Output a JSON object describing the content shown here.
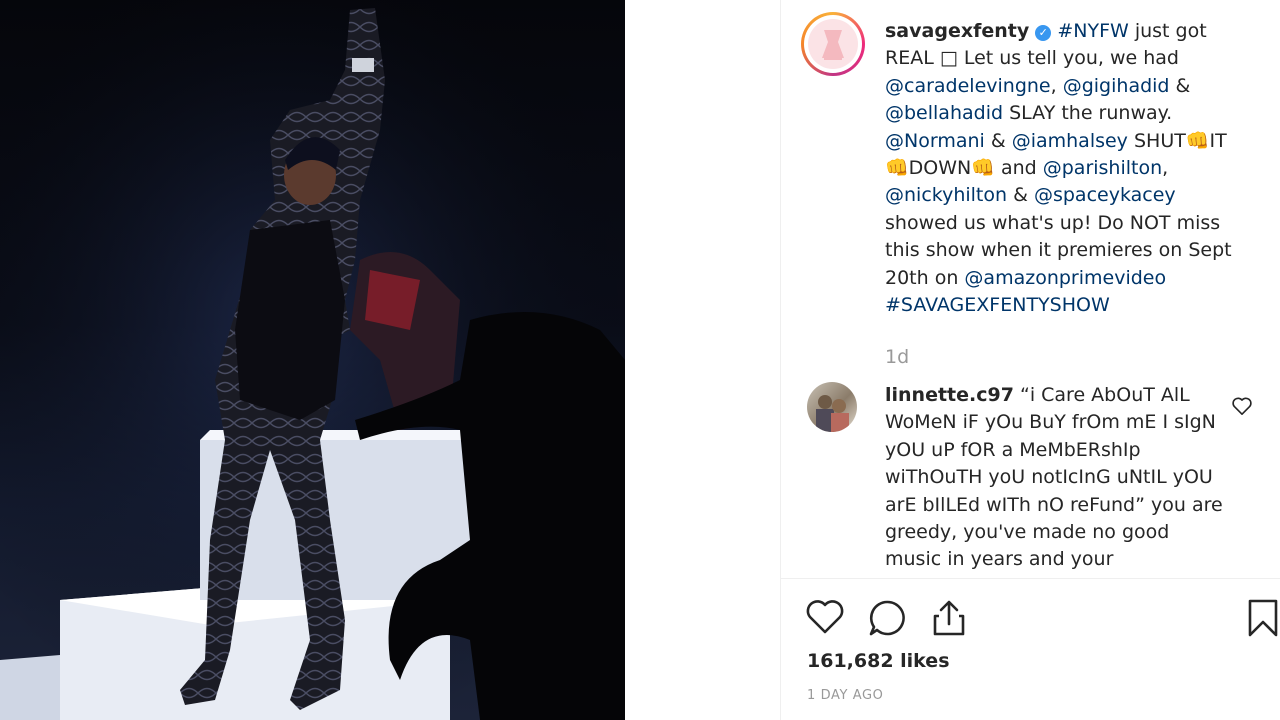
{
  "post": {
    "username": "savagexfenty",
    "caption_parts": [
      {
        "t": "#NYFW",
        "tag": true
      },
      {
        "t": " just got REAL □ Let us tell you, we had ",
        "tag": false
      },
      {
        "t": "@caradelevingne",
        "tag": true
      },
      {
        "t": ", ",
        "tag": false
      },
      {
        "t": "@gigihadid",
        "tag": true
      },
      {
        "t": " & ",
        "tag": false
      },
      {
        "t": "@bellahadid",
        "tag": true
      },
      {
        "t": " SLAY the runway. ",
        "tag": false
      },
      {
        "t": "@Normani",
        "tag": true
      },
      {
        "t": " & ",
        "tag": false
      },
      {
        "t": "@iamhalsey",
        "tag": true
      },
      {
        "t": " SHUT👊IT 👊DOWN👊 and ",
        "tag": false
      },
      {
        "t": "@parishilton",
        "tag": true
      },
      {
        "t": ", ",
        "tag": false
      },
      {
        "t": "@nickyhilton",
        "tag": true
      },
      {
        "t": " & ",
        "tag": false
      },
      {
        "t": "@spaceykacey",
        "tag": true
      },
      {
        "t": " showed us what's up! Do NOT miss this show when it premieres on Sept 20th on ",
        "tag": false
      },
      {
        "t": "@amazonprimevideo",
        "tag": true
      },
      {
        "t": " ",
        "tag": false
      },
      {
        "t": "#SAVAGEXFENTYSHOW",
        "tag": true
      }
    ],
    "age": "1d"
  },
  "comment": {
    "username": "linnette.c97",
    "text": "“i Care AbOuT AlL WoMeN iF yOu BuY frOm mE I sIgN yOU uP fOR a MeMbERshIp wiThOuTH yoU notIcInG uNtIL yOU arE bIlLEd wITh nO reFund” you are greedy, you've made no good music in years and your"
  },
  "actions": {
    "like_icon": "heart-icon",
    "comment_icon": "comment-icon",
    "share_icon": "share-icon",
    "save_icon": "bookmark-icon"
  },
  "likes": "161,682 likes",
  "date": "1 DAY AGO",
  "colors": {
    "tag": "#003569",
    "text": "#262626",
    "muted": "#999999",
    "verified": "#3897f0"
  }
}
